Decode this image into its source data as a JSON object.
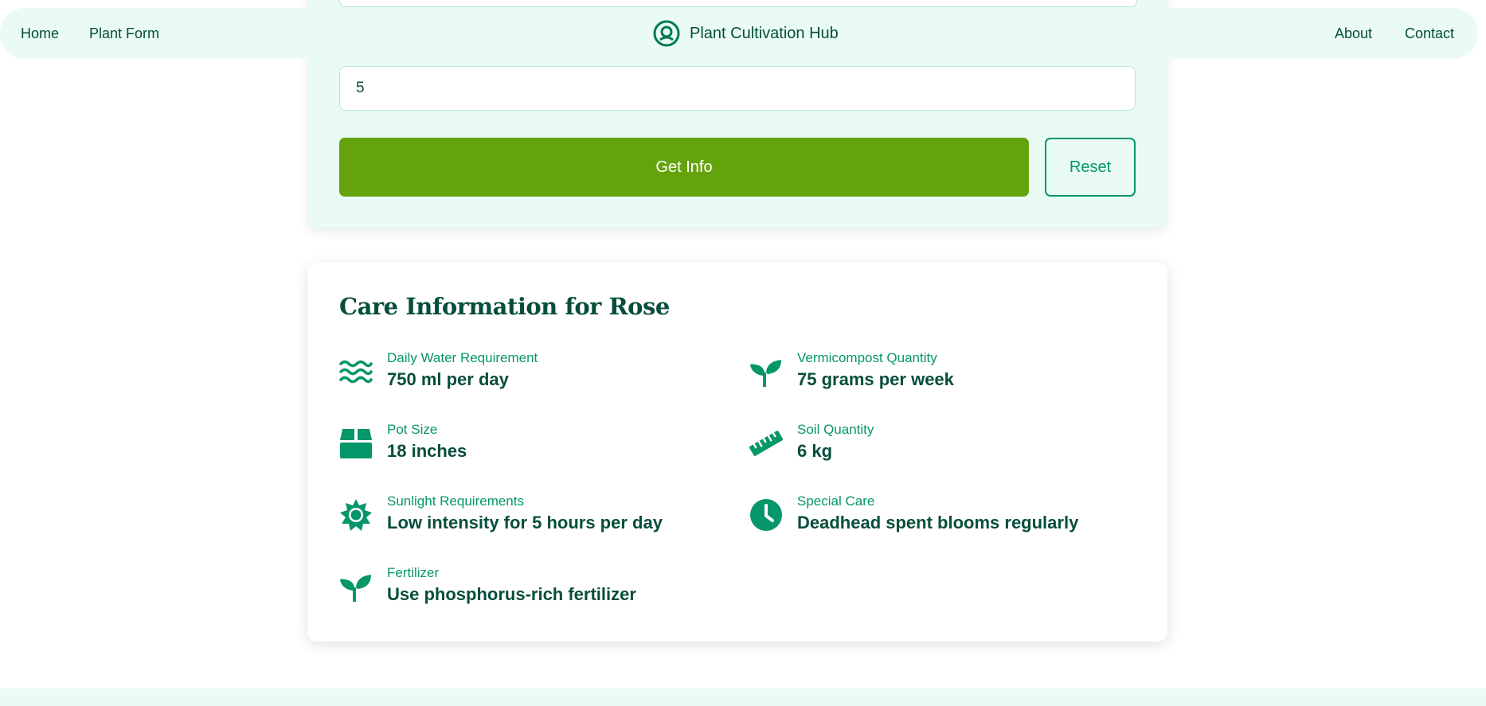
{
  "nav": {
    "home": "Home",
    "plant_form": "Plant Form",
    "brand": "Plant Cultivation Hub",
    "about": "About",
    "contact": "Contact"
  },
  "form": {
    "number_value": "5",
    "get_info_label": "Get Info",
    "reset_label": "Reset"
  },
  "care": {
    "title": "Care Information for Rose",
    "items": [
      {
        "icon": "water-icon",
        "label": "Daily Water Requirement",
        "value": "750 ml per day"
      },
      {
        "icon": "sprout-icon",
        "label": "Vermicompost Quantity",
        "value": "75 grams per week"
      },
      {
        "icon": "box-icon",
        "label": "Pot Size",
        "value": "18 inches"
      },
      {
        "icon": "ruler-icon",
        "label": "Soil Quantity",
        "value": "6 kg"
      },
      {
        "icon": "sun-icon",
        "label": "Sunlight Requirements",
        "value": "Low intensity for 5 hours per day"
      },
      {
        "icon": "clock-icon",
        "label": "Special Care",
        "value": "Deadhead spent blooms regularly"
      },
      {
        "icon": "sprout-icon",
        "label": "Fertilizer",
        "value": "Use phosphorus-rich fertilizer"
      }
    ]
  },
  "colors": {
    "primary_dark": "#064e3b",
    "accent": "#059669",
    "button_green": "#65a30d",
    "light_bg": "#e9fbf2"
  }
}
